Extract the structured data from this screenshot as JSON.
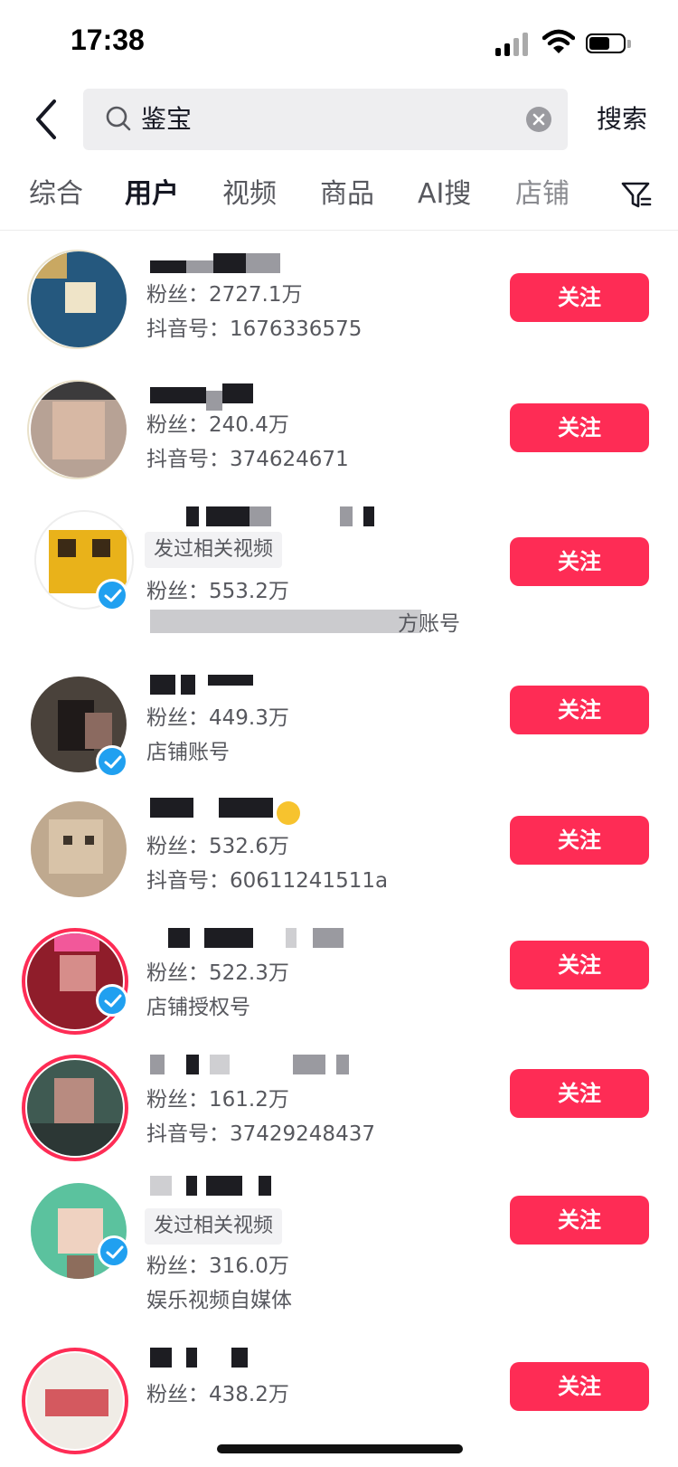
{
  "status_bar": {
    "time": "17:38"
  },
  "search": {
    "query": "鉴宝",
    "button": "搜索"
  },
  "tabs": [
    {
      "label": "综合"
    },
    {
      "label": "用户"
    },
    {
      "label": "视频"
    },
    {
      "label": "商品"
    },
    {
      "label": "AI搜"
    },
    {
      "label": "店铺"
    }
  ],
  "follow_label": "关注",
  "users": [
    {
      "fans": "粉丝：2727.1万",
      "line2": "抖音号：1676336575"
    },
    {
      "fans": "粉丝：240.4万",
      "line2": "抖音号：374624671"
    },
    {
      "tag": "发过相关视频",
      "fans": "粉丝：553.2万",
      "line2": "方账号"
    },
    {
      "fans": "粉丝：449.3万",
      "line2": "店铺账号"
    },
    {
      "fans": "粉丝：532.6万",
      "line2": "抖音号：60611241511a"
    },
    {
      "fans": "粉丝：522.3万",
      "line2": "店铺授权号"
    },
    {
      "fans": "粉丝：161.2万",
      "line2": "抖音号：37429248437"
    },
    {
      "tag": "发过相关视频",
      "fans": "粉丝：316.0万",
      "line2": "娱乐视频自媒体"
    },
    {
      "fans": "粉丝：438.2万",
      "line2": ""
    }
  ],
  "colors": {
    "accent": "#fe2c55",
    "verified": "#20a0f0"
  }
}
